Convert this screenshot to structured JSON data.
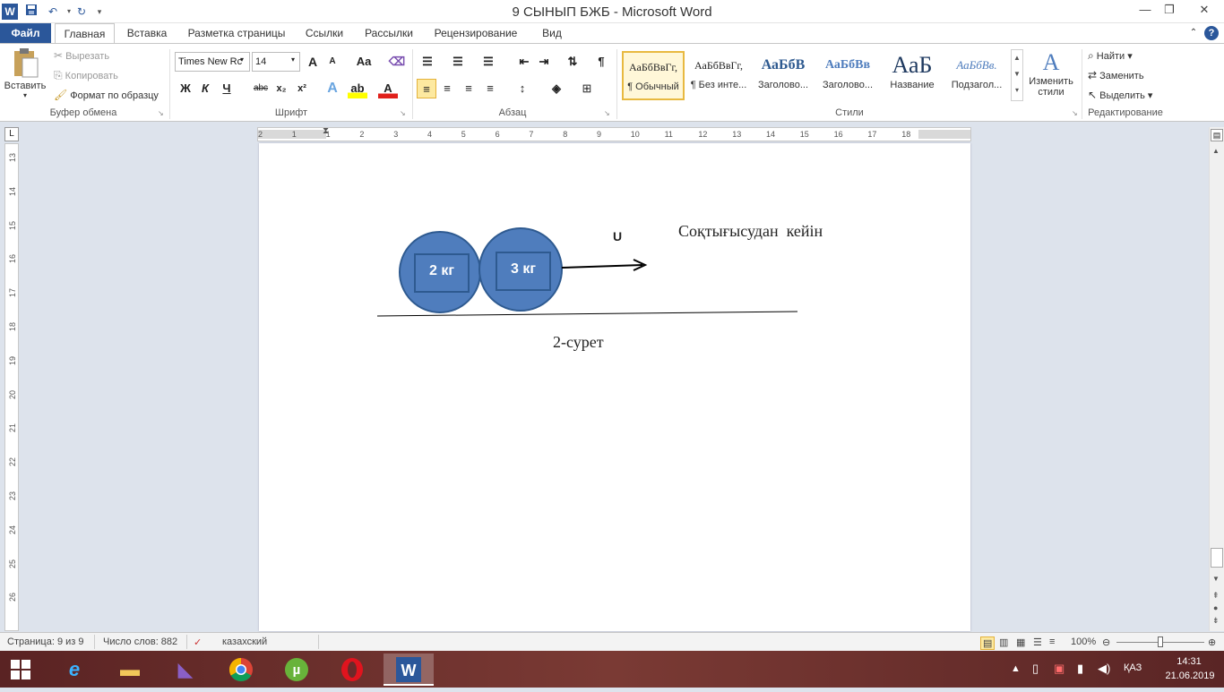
{
  "window": {
    "title": "9 СЫНЫП БЖБ  -  Microsoft Word",
    "qat": {
      "word_icon": "W",
      "save_icon": "floppy",
      "undo_icon": "↶",
      "redo_icon": "↻"
    }
  },
  "tabs": [
    "Файл",
    "Главная",
    "Вставка",
    "Разметка страницы",
    "Ссылки",
    "Рассылки",
    "Рецензирование",
    "Вид"
  ],
  "clipboard": {
    "paste": "Вставить",
    "cut": "Вырезать",
    "copy": "Копировать",
    "format_painter": "Формат по образцу",
    "group": "Буфер обмена"
  },
  "font": {
    "name": "Times New Rc",
    "size": "14",
    "grow": "A",
    "shrink": "A",
    "case": "Aa",
    "bold": "Ж",
    "italic": "К",
    "underline": "Ч",
    "strike": "abc",
    "subscript": "x₂",
    "superscript": "x²",
    "group": "Шрифт"
  },
  "paragraph": {
    "group": "Абзац",
    "pilcrow": "¶"
  },
  "styles": {
    "items": [
      {
        "sample": "АаБбВвГг,",
        "name": "¶ Обычный"
      },
      {
        "sample": "АаБбВвГг,",
        "name": "¶ Без инте..."
      },
      {
        "sample": "АаБбВ",
        "name": "Заголово..."
      },
      {
        "sample": "АаБбВв",
        "name": "Заголово..."
      },
      {
        "sample": "АаБ",
        "name": "Название"
      },
      {
        "sample": "АаБбВв.",
        "name": "Подзагол..."
      }
    ],
    "change": "Изменить стили",
    "group": "Стили"
  },
  "editing": {
    "find": "Найти",
    "replace": "Заменить",
    "select": "Выделить",
    "group": "Редактирование"
  },
  "ruler": {
    "h_ticks": [
      "2",
      "1",
      "1",
      "2",
      "3",
      "4",
      "5",
      "6",
      "7",
      "8",
      "9",
      "10",
      "11",
      "12",
      "13",
      "14",
      "15",
      "16",
      "17",
      "18"
    ],
    "v_ticks": [
      "13",
      "14",
      "15",
      "16",
      "17",
      "18",
      "19",
      "20",
      "21",
      "22",
      "23",
      "24",
      "25",
      "26"
    ]
  },
  "document": {
    "ball1_label": "2 кг",
    "ball2_label": "3 кг",
    "velocity_label": "U",
    "caption_after": "Соқтығысудан  кейін",
    "figure_caption": "2-сурет"
  },
  "status": {
    "page": "Страница: 9 из 9",
    "words": "Число слов: 882",
    "language": "казахский",
    "zoom": "100%"
  },
  "taskbar": {
    "lang": "ҚАЗ",
    "time": "14:31",
    "date": "21.06.2019"
  },
  "colors": {
    "word_blue": "#2b579a",
    "ball_fill": "#4f7dbd",
    "ball_stroke": "#2e5a90"
  }
}
